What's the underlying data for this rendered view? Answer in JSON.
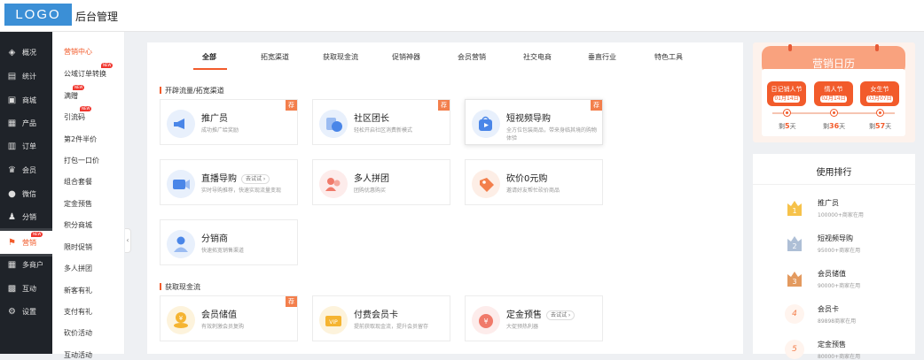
{
  "header": {
    "logo": "LOGO",
    "title": "后台管理"
  },
  "rail": [
    {
      "icon": "layers-icon",
      "label": "概况"
    },
    {
      "icon": "chart-icon",
      "label": "统计"
    },
    {
      "icon": "shop-icon",
      "label": "商城"
    },
    {
      "icon": "grid-icon",
      "label": "产品"
    },
    {
      "icon": "order-icon",
      "label": "订单"
    },
    {
      "icon": "crown-icon",
      "label": "会员"
    },
    {
      "icon": "chat-icon",
      "label": "微信"
    },
    {
      "icon": "share-icon",
      "label": "分销"
    },
    {
      "icon": "flag-icon",
      "label": "营销",
      "badge": "NEW"
    },
    {
      "icon": "store-icon",
      "label": "多商户"
    },
    {
      "icon": "interact-icon",
      "label": "互动"
    },
    {
      "icon": "gear-icon",
      "label": "设置"
    }
  ],
  "submenu": [
    {
      "label": "营销中心"
    },
    {
      "label": "公域订单转换",
      "badge": "NEW"
    },
    {
      "label": "满赠",
      "badge": "NEW"
    },
    {
      "label": "引流码",
      "badge": "NEW"
    },
    {
      "label": "第2件半价"
    },
    {
      "label": "打包一口价"
    },
    {
      "label": "组合套餐"
    },
    {
      "label": "定金预售"
    },
    {
      "label": "积分商城"
    },
    {
      "label": "限时促销"
    },
    {
      "label": "多人拼团"
    },
    {
      "label": "新客有礼"
    },
    {
      "label": "支付有礼"
    },
    {
      "label": "砍价活动"
    },
    {
      "label": "互动活动"
    }
  ],
  "tabs": [
    "全部",
    "拓宽渠道",
    "获取现金流",
    "促销神器",
    "会员营销",
    "社交电商",
    "垂直行业",
    "特色工具"
  ],
  "sections": [
    {
      "title": "开辟流量/拓宽渠道"
    },
    {
      "title": "获取现金流"
    }
  ],
  "cards": [
    {
      "title": "推广员",
      "desc": "成功推广给奖励",
      "tag": "荐",
      "icon": "megaphone-icon",
      "color": "#4a86e8"
    },
    {
      "title": "社区团长",
      "desc": "轻松开启社区消费新模式",
      "tag": "荐",
      "icon": "community-leader-icon",
      "color": "#4a86e8"
    },
    {
      "title": "短视频导购",
      "desc": "全方位包装商品，带来身临其境的购物体验",
      "tag": "荐",
      "icon": "video-shopping-icon",
      "color": "#4a86e8"
    },
    {
      "title": "直播导购",
      "desc": "实时导购推荐，快速实现流量变现",
      "try": "去试试 ›",
      "icon": "live-icon",
      "color": "#4a86e8"
    },
    {
      "title": "多人拼团",
      "desc": "团购优惠购买",
      "icon": "group-buy-icon",
      "color": "#f07a6a"
    },
    {
      "title": "砍价0元购",
      "desc": "邀请好友帮忙砍价商品",
      "icon": "bargain-icon",
      "color": "#f37f4c"
    },
    {
      "title": "分销商",
      "desc": "快速拓宽销售渠道",
      "icon": "distributor-icon",
      "color": "#4a86e8"
    },
    {
      "title": "会员储值",
      "desc": "有效刺激会员复购",
      "tag": "荐",
      "icon": "coin-icon",
      "color": "#f5b431"
    },
    {
      "title": "付费会员卡",
      "desc": "提前获取现金流，提升会员留存",
      "icon": "vip-card-icon",
      "color": "#f5b431"
    },
    {
      "title": "定金预售",
      "desc": "大促预热利器",
      "try": "去试试 ›",
      "icon": "presale-icon",
      "color": "#f07a6a"
    }
  ],
  "calendar": {
    "title": "营销日历",
    "events": [
      {
        "name": "日记销人节",
        "date": "01月14日",
        "prefix": "剩",
        "days": "5",
        "suffix": "天"
      },
      {
        "name": "情人节",
        "date": "02月14日",
        "prefix": "剩",
        "days": "36",
        "suffix": "天"
      },
      {
        "name": "女生节",
        "date": "03月07日",
        "prefix": "剩",
        "days": "57",
        "suffix": "天"
      }
    ]
  },
  "ranking": {
    "title": "使用排行",
    "items": [
      {
        "rank": "1",
        "name": "推广员",
        "stat": "100000+商家在用",
        "icon": "gold-medal-icon"
      },
      {
        "rank": "2",
        "name": "短视频导购",
        "stat": "95000+商家在用",
        "icon": "silver-medal-icon"
      },
      {
        "rank": "3",
        "name": "会员储值",
        "stat": "90000+商家在用",
        "icon": "bronze-medal-icon"
      },
      {
        "rank": "4",
        "name": "会员卡",
        "stat": "89898商家在用"
      },
      {
        "rank": "5",
        "name": "定金预售",
        "stat": "80000+商家在用"
      }
    ]
  },
  "colors": {
    "accent": "#f25b2b",
    "rail": "#1f2329",
    "logo": "#3b8fd6"
  }
}
